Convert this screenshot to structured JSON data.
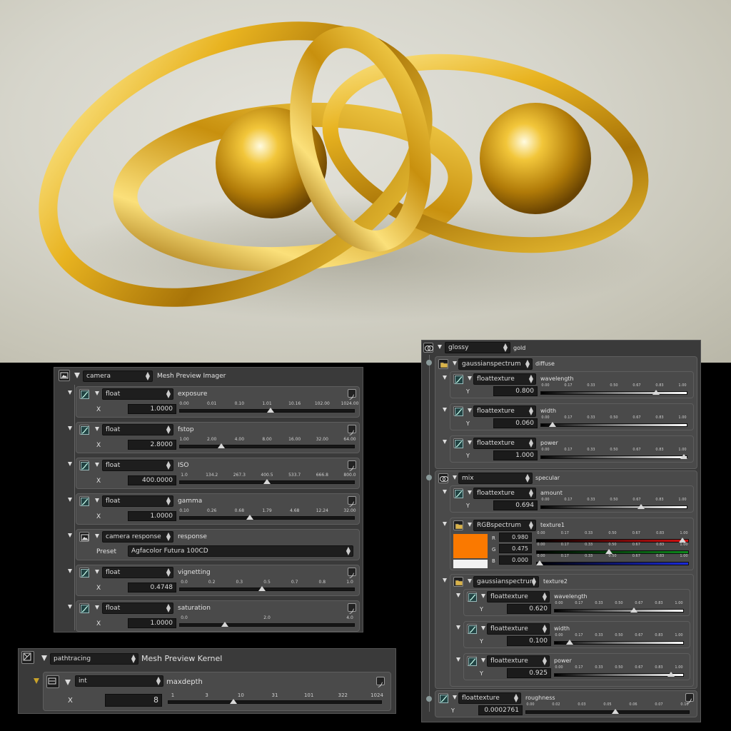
{
  "render": {
    "colors": {
      "gold": "#e7b221",
      "gold_light": "#fff3a8",
      "gold_dark": "#7a5204",
      "background": "#d6d5cb"
    }
  },
  "imager_panel": {
    "header": {
      "type": "camera",
      "label": "Mesh Preview Imager"
    },
    "rows": [
      {
        "type": "float",
        "param": "exposure",
        "axis": "X",
        "value": "1.0000",
        "ticks": [
          "0.00",
          "0.01",
          "0.10",
          "1.01",
          "10.16",
          "102.00",
          "1024.00"
        ],
        "position": 0.52
      },
      {
        "type": "float",
        "param": "fstop",
        "axis": "X",
        "value": "2.8000",
        "ticks": [
          "1.00",
          "2.00",
          "4.00",
          "8.00",
          "16.00",
          "32.00",
          "64.00"
        ],
        "position": 0.23
      },
      {
        "type": "float",
        "param": "ISO",
        "axis": "X",
        "value": "400.0000",
        "ticks": [
          "1.0",
          "134.2",
          "267.3",
          "400.5",
          "533.7",
          "666.8",
          "800.0"
        ],
        "position": 0.5
      },
      {
        "type": "float",
        "param": "gamma",
        "axis": "X",
        "value": "1.0000",
        "ticks": [
          "0.10",
          "0.26",
          "0.68",
          "1.79",
          "4.68",
          "12.24",
          "32.00"
        ],
        "position": 0.4
      },
      {
        "type": "camera response",
        "param": "response",
        "preset_label": "Preset",
        "preset_value": "Agfacolor Futura 100CD"
      },
      {
        "type": "float",
        "param": "vignetting",
        "axis": "X",
        "value": "0.4748",
        "ticks": [
          "0.0",
          "0.2",
          "0.3",
          "0.5",
          "0.7",
          "0.8",
          "1.0"
        ],
        "position": 0.47
      },
      {
        "type": "float",
        "param": "saturation",
        "axis": "X",
        "value": "1.0000",
        "ticks": [
          "0.0",
          "2.0",
          "4.0"
        ],
        "position": 0.25
      }
    ]
  },
  "kernel_panel": {
    "header": {
      "type": "pathtracing",
      "label": "Mesh Preview Kernel"
    },
    "row": {
      "type": "int",
      "param": "maxdepth",
      "axis": "X",
      "value": "8",
      "ticks": [
        "1",
        "3",
        "10",
        "31",
        "101",
        "322",
        "1024"
      ],
      "position": 0.3
    }
  },
  "material_panel": {
    "header": {
      "type": "glossy",
      "label": "gold"
    },
    "diffuse": {
      "type": "gaussianspectrum",
      "label": "diffuse",
      "rows": [
        {
          "type": "floattexture",
          "param": "wavelength",
          "axis": "Y",
          "value": "0.800",
          "position": 0.8
        },
        {
          "type": "floattexture",
          "param": "width",
          "axis": "Y",
          "value": "0.060",
          "position": 0.06
        },
        {
          "type": "floattexture",
          "param": "power",
          "axis": "Y",
          "value": "1.000",
          "position": 1.0
        }
      ]
    },
    "specular": {
      "type": "mix",
      "label": "specular",
      "amount": {
        "type": "floattexture",
        "param": "amount",
        "axis": "Y",
        "value": "0.694",
        "position": 0.694
      },
      "texture1": {
        "type": "RGBspectrum",
        "label": "texture1",
        "swatch_color": "#fa7900",
        "channels": [
          {
            "axis": "R",
            "value": "0.980",
            "position": 0.98,
            "color": "#d61010"
          },
          {
            "axis": "G",
            "value": "0.475",
            "position": 0.475,
            "color": "#0d8a1c"
          },
          {
            "axis": "B",
            "value": "0.000",
            "position": 0.0,
            "color": "#1a2adb"
          }
        ]
      },
      "texture2": {
        "type": "gaussianspectrum",
        "label": "texture2",
        "rows": [
          {
            "type": "floattexture",
            "param": "wavelength",
            "axis": "Y",
            "value": "0.620",
            "position": 0.62
          },
          {
            "type": "floattexture",
            "param": "width",
            "axis": "Y",
            "value": "0.100",
            "position": 0.1
          },
          {
            "type": "floattexture",
            "param": "power",
            "axis": "Y",
            "value": "0.925",
            "position": 0.925
          }
        ]
      }
    },
    "roughness": {
      "type": "floattexture",
      "param": "roughness",
      "axis": "Y",
      "value": "0.0002761",
      "ticks": [
        "0.00",
        "0.02",
        "0.03",
        "0.05",
        "0.06",
        "0.07",
        "0.10"
      ],
      "position": 0.55
    },
    "unit_ticks": [
      "0.00",
      "0.17",
      "0.33",
      "0.50",
      "0.67",
      "0.83",
      "1.00"
    ]
  }
}
